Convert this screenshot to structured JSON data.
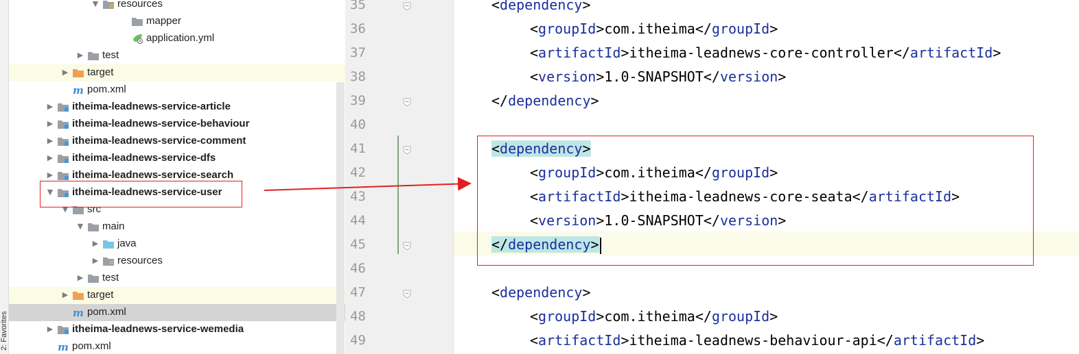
{
  "sidebar_strip": {
    "label": "2: Favorites"
  },
  "tree": {
    "rows": [
      {
        "label": "resources",
        "icon": "resources-folder-icon",
        "arrow": "down",
        "bold": false,
        "highlight": "",
        "indent": 120
      },
      {
        "label": "mapper",
        "icon": "folder-icon",
        "arrow": "",
        "bold": false,
        "highlight": "",
        "indent": 162
      },
      {
        "label": "application.yml",
        "icon": "yml-file-icon",
        "arrow": "",
        "bold": false,
        "highlight": "",
        "indent": 162
      },
      {
        "label": "test",
        "icon": "folder-icon",
        "arrow": "right",
        "bold": false,
        "highlight": "",
        "indent": 98
      },
      {
        "label": "target",
        "icon": "orange-folder-icon",
        "arrow": "right",
        "bold": false,
        "highlight": "yellow",
        "indent": 76
      },
      {
        "label": "pom.xml",
        "icon": "maven-icon",
        "arrow": "",
        "bold": false,
        "highlight": "",
        "indent": 76
      },
      {
        "label": "itheima-leadnews-service-article",
        "icon": "module-folder-icon",
        "arrow": "right",
        "bold": true,
        "highlight": "",
        "indent": 54
      },
      {
        "label": "itheima-leadnews-service-behaviour",
        "icon": "module-folder-icon",
        "arrow": "right",
        "bold": true,
        "highlight": "",
        "indent": 54
      },
      {
        "label": "itheima-leadnews-service-comment",
        "icon": "module-folder-icon",
        "arrow": "right",
        "bold": true,
        "highlight": "",
        "indent": 54
      },
      {
        "label": "itheima-leadnews-service-dfs",
        "icon": "module-folder-icon",
        "arrow": "right",
        "bold": true,
        "highlight": "",
        "indent": 54
      },
      {
        "label": "itheima-leadnews-service-search",
        "icon": "module-folder-icon",
        "arrow": "right",
        "bold": true,
        "highlight": "",
        "indent": 54
      },
      {
        "label": "itheima-leadnews-service-user",
        "icon": "module-folder-icon",
        "arrow": "down",
        "bold": true,
        "highlight": "",
        "indent": 54
      },
      {
        "label": "src",
        "icon": "folder-icon",
        "arrow": "down",
        "bold": false,
        "highlight": "",
        "indent": 76
      },
      {
        "label": "main",
        "icon": "folder-icon",
        "arrow": "down",
        "bold": false,
        "highlight": "",
        "indent": 98
      },
      {
        "label": "java",
        "icon": "source-folder-icon",
        "arrow": "right",
        "bold": false,
        "highlight": "",
        "indent": 120
      },
      {
        "label": "resources",
        "icon": "resources-folder-icon",
        "arrow": "right",
        "bold": false,
        "highlight": "",
        "indent": 120
      },
      {
        "label": "test",
        "icon": "folder-icon",
        "arrow": "right",
        "bold": false,
        "highlight": "",
        "indent": 98
      },
      {
        "label": "target",
        "icon": "orange-folder-icon",
        "arrow": "right",
        "bold": false,
        "highlight": "yellow",
        "indent": 76
      },
      {
        "label": "pom.xml",
        "icon": "maven-icon",
        "arrow": "",
        "bold": false,
        "highlight": "selected",
        "indent": 76
      },
      {
        "label": "itheima-leadnews-service-wemedia",
        "icon": "module-folder-icon",
        "arrow": "right",
        "bold": true,
        "highlight": "",
        "indent": 54
      },
      {
        "label": "pom.xml",
        "icon": "maven-icon",
        "arrow": "",
        "bold": false,
        "highlight": "",
        "indent": 54
      }
    ]
  },
  "editor": {
    "lines": [
      {
        "num": "35",
        "indent": 0,
        "kind": "open",
        "tag": "dependency",
        "text": "",
        "fold": true
      },
      {
        "num": "36",
        "indent": 1,
        "kind": "elem",
        "tag": "groupId",
        "text": "com.itheima",
        "fold": false
      },
      {
        "num": "37",
        "indent": 1,
        "kind": "elem",
        "tag": "artifactId",
        "text": "itheima-leadnews-core-controller",
        "fold": false
      },
      {
        "num": "38",
        "indent": 1,
        "kind": "elem",
        "tag": "version",
        "text": "1.0-SNAPSHOT",
        "fold": false
      },
      {
        "num": "39",
        "indent": 0,
        "kind": "close",
        "tag": "dependency",
        "text": "",
        "fold": true
      },
      {
        "num": "40",
        "indent": 0,
        "kind": "blank",
        "tag": "",
        "text": "",
        "fold": false
      },
      {
        "num": "41",
        "indent": 0,
        "kind": "open",
        "tag": "dependency",
        "text": "",
        "fold": true,
        "match": true
      },
      {
        "num": "42",
        "indent": 1,
        "kind": "elem",
        "tag": "groupId",
        "text": "com.itheima",
        "fold": false
      },
      {
        "num": "43",
        "indent": 1,
        "kind": "elem",
        "tag": "artifactId",
        "text": "itheima-leadnews-core-seata",
        "fold": false
      },
      {
        "num": "44",
        "indent": 1,
        "kind": "elem",
        "tag": "version",
        "text": "1.0-SNAPSHOT",
        "fold": false
      },
      {
        "num": "45",
        "indent": 0,
        "kind": "close",
        "tag": "dependency",
        "text": "",
        "fold": true,
        "match": true,
        "caret": true
      },
      {
        "num": "46",
        "indent": 0,
        "kind": "blank",
        "tag": "",
        "text": "",
        "fold": false
      },
      {
        "num": "47",
        "indent": 0,
        "kind": "open",
        "tag": "dependency",
        "text": "",
        "fold": true
      },
      {
        "num": "48",
        "indent": 1,
        "kind": "elem",
        "tag": "groupId",
        "text": "com.itheima",
        "fold": false
      },
      {
        "num": "49",
        "indent": 1,
        "kind": "elem",
        "tag": "artifactId",
        "text": "itheima-leadnews-behaviour-api",
        "fold": false
      }
    ]
  },
  "colors": {
    "tag": "#1a2f9d",
    "annotation": "#e02020",
    "match_bg": "#bfe6e6",
    "current_line": "#fbfbe9"
  }
}
